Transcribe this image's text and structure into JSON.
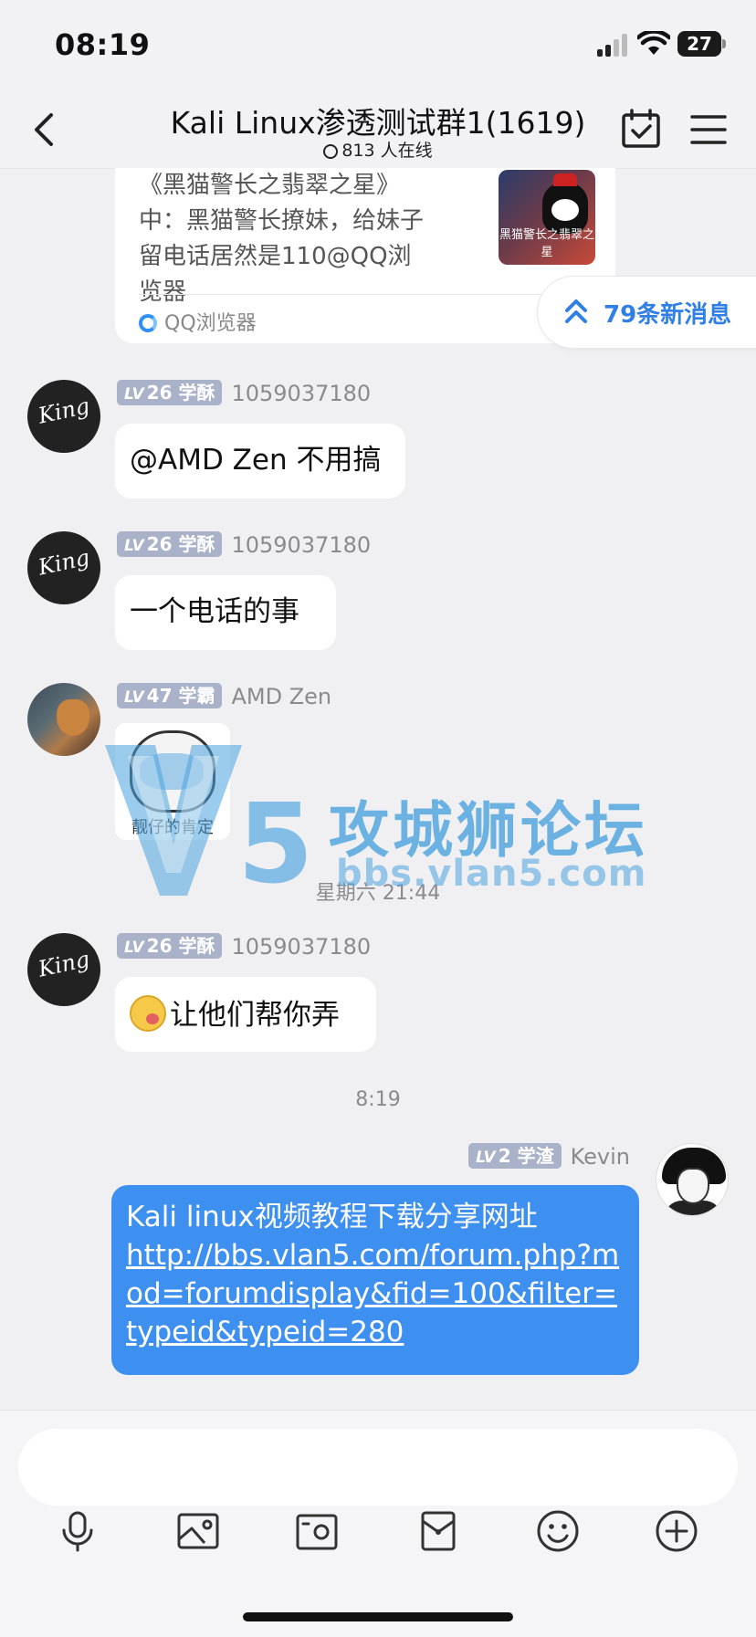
{
  "status": {
    "time": "08:19",
    "battery": "27"
  },
  "nav": {
    "title": "Kali Linux渗透测试群1(1619)",
    "online": "813 人在线"
  },
  "share_card": {
    "text": "《黑猫警长之翡翠之星》中：黑猫警长撩妹，给妹子留电话居然是110@QQ浏览器",
    "thumb_caption": "黑猫警长之翡翠之星",
    "source": "QQ浏览器"
  },
  "new_messages": "79条新消息",
  "messages": [
    {
      "badge_level": "26",
      "badge_title": "学酥",
      "sender": "1059037180",
      "text": "@AMD Zen 不用搞"
    },
    {
      "badge_level": "26",
      "badge_title": "学酥",
      "sender": "1059037180",
      "text": "一个电话的事"
    },
    {
      "badge_level": "47",
      "badge_title": "学霸",
      "sender": "AMD Zen",
      "sticker_caption": "靓仔的肯定"
    },
    {
      "badge_level": "26",
      "badge_title": "学酥",
      "sender": "1059037180",
      "text": "让他们帮你弄"
    }
  ],
  "time_separators": [
    "星期六 21:44",
    "8:19"
  ],
  "my_message": {
    "badge_level": "2",
    "badge_title": "学渣",
    "sender": "Kevin",
    "text": "Kali linux视频教程下载分享网址",
    "link": "http://bbs.vlan5.com/forum.php?mod=forumdisplay&fid=100&filter=typeid&typeid=280"
  },
  "badge_prefix": "LV",
  "avatar_text": "King",
  "watermark": {
    "brand": "攻城狮论坛",
    "url": "bbs.vlan5.com",
    "digit": "5"
  },
  "toolbar_icons": [
    "microphone-icon",
    "image-icon",
    "camera-icon",
    "red-packet-icon",
    "emoji-icon",
    "plus-icon"
  ],
  "colors": {
    "accent": "#2f7fe6",
    "my_bubble": "#3d8ff0",
    "badge": "#a9b2c8",
    "background": "#f0f0f2"
  }
}
